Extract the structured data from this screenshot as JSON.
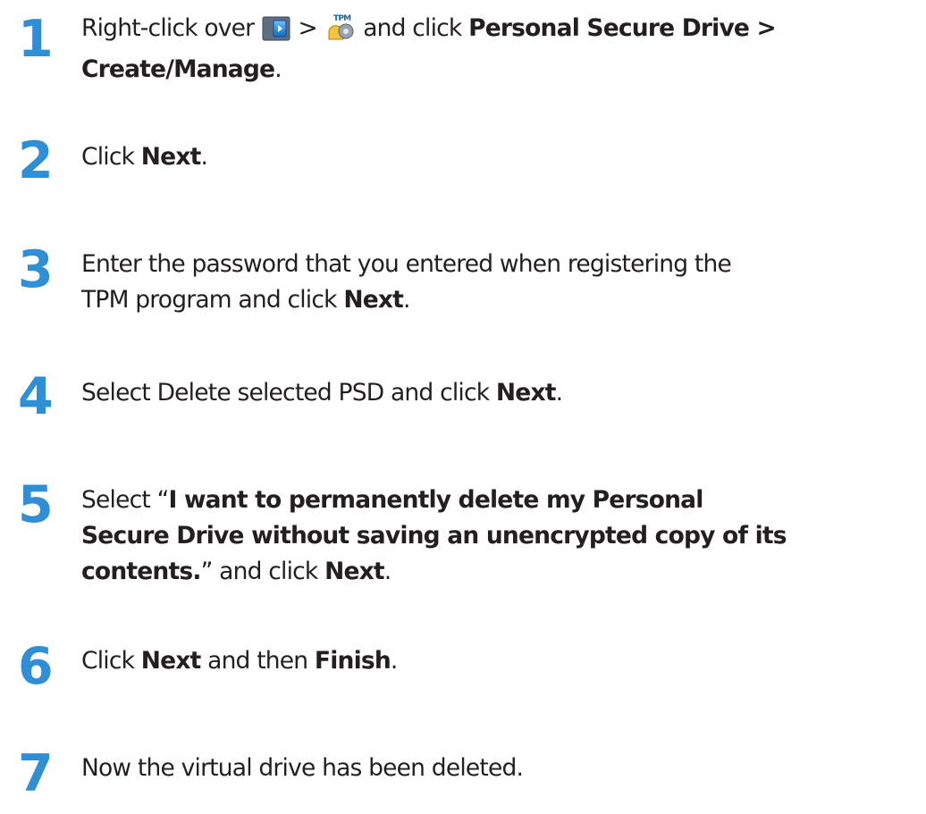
{
  "steps": [
    {
      "number": "1",
      "line1": {
        "pre": "Right-click over",
        "gt": ">",
        "mid": "and click",
        "bold": "Personal Secure Drive >"
      },
      "line2": {
        "bold": "Create/Manage",
        "post": "."
      }
    },
    {
      "number": "2",
      "pre": "Click",
      "bold": "Next",
      "post": "."
    },
    {
      "number": "3",
      "line1": "Enter the password that you entered when registering the",
      "line2": {
        "pre": "TPM program and click",
        "bold": "Next",
        "post": "."
      }
    },
    {
      "number": "4",
      "pre": "Select Delete selected PSD and click",
      "bold": "Next",
      "post": "."
    },
    {
      "number": "5",
      "line1": {
        "pre": "Select “",
        "bold": "I want to permanently delete my Personal"
      },
      "line2": {
        "bold": "Secure Drive without saving an unencrypted copy of its"
      },
      "line3": {
        "bold": "contents.",
        "mid": "” and click",
        "bold2": "Next",
        "post": "."
      }
    },
    {
      "number": "6",
      "pre": "Click",
      "bold": "Next",
      "mid": "and then",
      "bold2": "Finish",
      "post": "."
    },
    {
      "number": "7",
      "text": "Now the virtual drive has been deleted."
    }
  ],
  "icons": {
    "play": "play-arrow-icon",
    "tpm": "tpm-icon",
    "tpm_label": "TPM"
  },
  "colors": {
    "step_number": "#2e8fd6",
    "text": "#231f20"
  }
}
